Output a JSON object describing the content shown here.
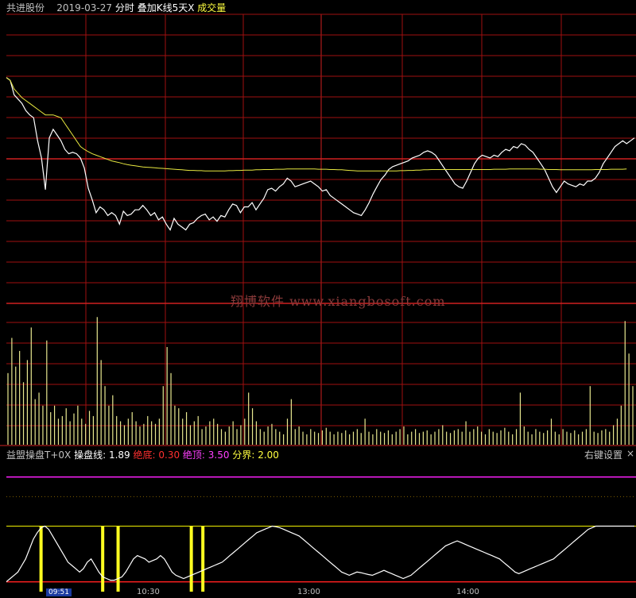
{
  "header": {
    "stock_name": "共进股份",
    "date": "2019-03-27",
    "mode": "分时",
    "overlay": "叠加K线5天X",
    "volume": "成交量"
  },
  "indicator": {
    "name": "益盟操盘T+0X",
    "line_label": "操盘线:",
    "line_value": "1.89",
    "bottom_label": "绝底:",
    "bottom_value": "0.30",
    "top_label": "绝顶:",
    "top_value": "3.50",
    "divide_label": "分界:",
    "divide_value": "2.00",
    "settings": "右键设置",
    "close": "×"
  },
  "watermark": "翔博软件 www.xiangbosoft.com",
  "time_axis": {
    "first_label": "09:51",
    "labels": [
      "10:30",
      "13:00",
      "14:00"
    ]
  },
  "colors": {
    "background": "#000000",
    "grid": "#a01010",
    "price_line": "#ffffff",
    "avg_line": "#e8e840",
    "volume_bar": "#e8e890",
    "zone_bar": "#ffff20",
    "magenta_line": "#ff20ff"
  },
  "chart_data": [
    {
      "type": "line",
      "panel": "price",
      "title": "",
      "x": [
        0,
        1,
        2,
        3,
        4,
        5,
        6,
        7,
        8,
        9,
        10,
        11,
        12,
        13,
        14,
        15,
        16,
        17,
        18,
        19,
        20,
        21,
        22,
        23,
        24,
        25,
        26,
        27,
        28,
        29,
        30,
        31,
        32,
        33,
        34,
        35,
        36,
        37,
        38,
        39,
        40,
        41,
        42,
        43,
        44,
        45,
        46,
        47,
        48,
        49,
        50,
        51,
        52,
        53,
        54,
        55,
        56,
        57,
        58,
        59,
        60,
        61,
        62,
        63,
        64,
        65,
        66,
        67,
        68,
        69,
        70,
        71,
        72,
        73,
        74,
        75,
        76,
        77,
        78,
        79,
        80,
        81,
        82,
        83,
        84,
        85,
        86,
        87,
        88,
        89,
        90,
        91,
        92,
        93,
        94,
        95,
        96,
        97,
        98,
        99,
        100,
        101,
        102,
        103,
        104,
        105,
        106,
        107,
        108,
        109,
        110,
        111,
        112,
        113,
        114,
        115,
        116,
        117,
        118,
        119,
        120,
        121,
        122,
        123,
        124,
        125,
        126,
        127,
        128,
        129,
        130,
        131,
        132,
        133,
        134,
        135,
        136,
        137,
        138,
        139,
        140,
        141,
        142,
        143,
        144,
        145,
        146,
        147,
        148,
        149,
        150,
        151,
        152,
        153,
        154,
        155,
        156,
        157,
        158,
        159
      ],
      "series": [
        {
          "values": [
            0.78,
            0.77,
            0.72,
            0.705,
            0.69,
            0.665,
            0.65,
            0.64,
            0.56,
            0.5,
            0.39,
            0.57,
            0.6,
            0.58,
            0.56,
            0.53,
            0.515,
            0.52,
            0.515,
            0.5,
            0.465,
            0.395,
            0.355,
            0.31,
            0.33,
            0.32,
            0.3,
            0.31,
            0.3,
            0.27,
            0.315,
            0.3,
            0.305,
            0.32,
            0.32,
            0.335,
            0.32,
            0.3,
            0.31,
            0.285,
            0.295,
            0.27,
            0.25,
            0.29,
            0.27,
            0.26,
            0.25,
            0.27,
            0.275,
            0.29,
            0.3,
            0.305,
            0.285,
            0.295,
            0.28,
            0.3,
            0.295,
            0.32,
            0.34,
            0.335,
            0.31,
            0.33,
            0.33,
            0.345,
            0.32,
            0.34,
            0.36,
            0.39,
            0.395,
            0.385,
            0.4,
            0.41,
            0.43,
            0.42,
            0.4,
            0.405,
            0.41,
            0.415,
            0.42,
            0.41,
            0.4,
            0.385,
            0.39,
            0.37,
            0.36,
            0.35,
            0.34,
            0.33,
            0.32,
            0.31,
            0.305,
            0.3,
            0.32,
            0.345,
            0.375,
            0.4,
            0.425,
            0.44,
            0.46,
            0.47,
            0.475,
            0.48,
            0.485,
            0.49,
            0.5,
            0.505,
            0.51,
            0.52,
            0.525,
            0.52,
            0.51,
            0.49,
            0.47,
            0.45,
            0.43,
            0.41,
            0.4,
            0.395,
            0.42,
            0.45,
            0.48,
            0.5,
            0.51,
            0.505,
            0.5,
            0.51,
            0.505,
            0.52,
            0.53,
            0.525,
            0.54,
            0.535,
            0.55,
            0.545,
            0.53,
            0.52,
            0.5,
            0.48,
            0.46,
            0.43,
            0.4,
            0.38,
            0.4,
            0.42,
            0.41,
            0.405,
            0.4,
            0.41,
            0.405,
            0.42,
            0.42,
            0.43,
            0.45,
            0.48,
            0.5,
            0.52,
            0.54,
            0.55,
            0.56,
            0.55,
            0.56,
            0.57
          ],
          "avg": [
            0.78,
            0.77,
            0.74,
            0.725,
            0.71,
            0.7,
            0.69,
            0.68,
            0.67,
            0.66,
            0.65,
            0.65,
            0.65,
            0.645,
            0.64,
            0.62,
            0.6,
            0.58,
            0.56,
            0.54,
            0.53,
            0.522,
            0.515,
            0.51,
            0.505,
            0.5,
            0.495,
            0.49,
            0.487,
            0.484,
            0.48,
            0.477,
            0.475,
            0.473,
            0.471,
            0.469,
            0.468,
            0.467,
            0.466,
            0.465,
            0.464,
            0.463,
            0.462,
            0.461,
            0.46,
            0.459,
            0.458,
            0.457,
            0.457,
            0.456,
            0.456,
            0.455,
            0.455,
            0.455,
            0.455,
            0.455,
            0.455,
            0.456,
            0.456,
            0.457,
            0.457,
            0.458,
            0.458,
            0.458,
            0.459,
            0.459,
            0.46,
            0.46,
            0.46,
            0.461,
            0.461,
            0.461,
            0.462,
            0.462,
            0.462,
            0.462,
            0.462,
            0.462,
            0.462,
            0.462,
            0.461,
            0.461,
            0.461,
            0.46,
            0.46,
            0.459,
            0.459,
            0.458,
            0.457,
            0.456,
            0.455,
            0.455,
            0.455,
            0.455,
            0.455,
            0.455,
            0.455,
            0.455,
            0.455,
            0.455,
            0.455,
            0.456,
            0.456,
            0.457,
            0.457,
            0.458,
            0.458,
            0.459,
            0.459,
            0.46,
            0.46,
            0.46,
            0.46,
            0.46,
            0.46,
            0.46,
            0.46,
            0.46,
            0.46,
            0.46,
            0.46,
            0.46,
            0.46,
            0.46,
            0.46,
            0.461,
            0.461,
            0.461,
            0.461,
            0.462,
            0.462,
            0.462,
            0.462,
            0.462,
            0.462,
            0.462,
            0.462,
            0.461,
            0.461,
            0.46,
            0.46,
            0.46,
            0.459,
            0.459,
            0.459,
            0.459,
            0.459,
            0.459,
            0.459,
            0.459,
            0.459,
            0.46,
            0.46,
            0.46,
            0.46,
            0.461,
            0.461,
            0.461,
            0.461,
            0.462
          ]
        }
      ]
    },
    {
      "type": "bar",
      "panel": "volume",
      "title": "成交量",
      "values": [
        0.55,
        0.82,
        0.6,
        0.72,
        0.48,
        0.65,
        0.9,
        0.35,
        0.4,
        0.3,
        0.8,
        0.25,
        0.3,
        0.2,
        0.22,
        0.28,
        0.18,
        0.24,
        0.3,
        0.2,
        0.16,
        0.26,
        0.22,
        0.98,
        0.65,
        0.45,
        0.3,
        0.38,
        0.22,
        0.18,
        0.15,
        0.2,
        0.25,
        0.18,
        0.14,
        0.16,
        0.22,
        0.18,
        0.16,
        0.2,
        0.45,
        0.75,
        0.55,
        0.3,
        0.28,
        0.2,
        0.25,
        0.15,
        0.18,
        0.22,
        0.12,
        0.14,
        0.18,
        0.2,
        0.16,
        0.12,
        0.1,
        0.14,
        0.18,
        0.12,
        0.15,
        0.2,
        0.4,
        0.28,
        0.18,
        0.12,
        0.1,
        0.14,
        0.16,
        0.12,
        0.1,
        0.08,
        0.2,
        0.35,
        0.12,
        0.14,
        0.1,
        0.08,
        0.12,
        0.1,
        0.09,
        0.11,
        0.13,
        0.1,
        0.08,
        0.1,
        0.09,
        0.11,
        0.08,
        0.1,
        0.12,
        0.09,
        0.2,
        0.1,
        0.08,
        0.12,
        0.1,
        0.09,
        0.11,
        0.08,
        0.1,
        0.12,
        0.14,
        0.08,
        0.1,
        0.12,
        0.09,
        0.1,
        0.11,
        0.08,
        0.1,
        0.12,
        0.15,
        0.1,
        0.09,
        0.11,
        0.12,
        0.1,
        0.18,
        0.1,
        0.12,
        0.14,
        0.1,
        0.08,
        0.12,
        0.1,
        0.09,
        0.11,
        0.13,
        0.1,
        0.08,
        0.12,
        0.4,
        0.14,
        0.1,
        0.08,
        0.12,
        0.1,
        0.09,
        0.11,
        0.2,
        0.1,
        0.08,
        0.12,
        0.1,
        0.09,
        0.11,
        0.08,
        0.1,
        0.12,
        0.45,
        0.1,
        0.09,
        0.11,
        0.12,
        0.1,
        0.15,
        0.2,
        0.3,
        0.95,
        0.7,
        0.45
      ]
    },
    {
      "type": "line",
      "panel": "indicator",
      "title": "益盟操盘T+0X",
      "ylim": [
        0,
        4
      ],
      "reference_lines": [
        0.3,
        2.0,
        3.5
      ],
      "zone_bars": [
        9,
        25,
        29,
        48,
        51
      ],
      "values": [
        0.3,
        0.4,
        0.5,
        0.6,
        0.8,
        1.0,
        1.3,
        1.6,
        1.8,
        1.95,
        2.0,
        1.9,
        1.7,
        1.5,
        1.3,
        1.1,
        0.9,
        0.8,
        0.7,
        0.6,
        0.7,
        0.9,
        1.0,
        0.8,
        0.6,
        0.45,
        0.4,
        0.35,
        0.35,
        0.4,
        0.45,
        0.6,
        0.8,
        1.0,
        1.1,
        1.05,
        1.0,
        0.9,
        0.95,
        1.0,
        1.1,
        1.0,
        0.8,
        0.6,
        0.5,
        0.45,
        0.4,
        0.45,
        0.5,
        0.55,
        0.6,
        0.65,
        0.7,
        0.75,
        0.8,
        0.85,
        0.9,
        1.0,
        1.1,
        1.2,
        1.3,
        1.4,
        1.5,
        1.6,
        1.7,
        1.8,
        1.85,
        1.9,
        1.95,
        2.0,
        1.98,
        1.95,
        1.9,
        1.85,
        1.8,
        1.75,
        1.7,
        1.6,
        1.5,
        1.4,
        1.3,
        1.2,
        1.1,
        1.0,
        0.9,
        0.8,
        0.7,
        0.6,
        0.55,
        0.5,
        0.55,
        0.6,
        0.58,
        0.55,
        0.52,
        0.5,
        0.55,
        0.6,
        0.65,
        0.6,
        0.55,
        0.5,
        0.45,
        0.4,
        0.45,
        0.5,
        0.6,
        0.7,
        0.8,
        0.9,
        1.0,
        1.1,
        1.2,
        1.3,
        1.4,
        1.45,
        1.5,
        1.55,
        1.5,
        1.45,
        1.4,
        1.35,
        1.3,
        1.25,
        1.2,
        1.15,
        1.1,
        1.05,
        1.0,
        0.9,
        0.8,
        0.7,
        0.6,
        0.55,
        0.6,
        0.65,
        0.7,
        0.75,
        0.8,
        0.85,
        0.9,
        0.95,
        1.0,
        1.1,
        1.2,
        1.3,
        1.4,
        1.5,
        1.6,
        1.7,
        1.8,
        1.9,
        1.95,
        2.0,
        2.0,
        2.0,
        2.0,
        2.0,
        2.0,
        2.0,
        2.0,
        2.0,
        2.0,
        2.0
      ]
    }
  ]
}
